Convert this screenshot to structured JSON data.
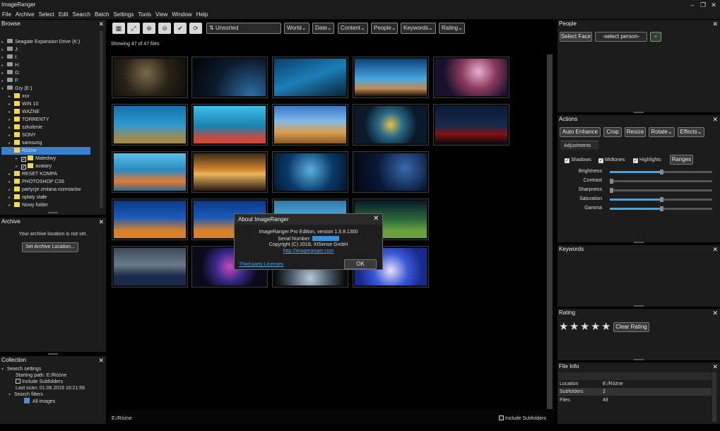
{
  "app": {
    "title": "ImageRanger"
  },
  "menu": [
    "File",
    "Archive",
    "Select",
    "Edit",
    "Search",
    "Batch",
    "Settings",
    "Tools",
    "View",
    "Window",
    "Help"
  ],
  "browse": {
    "title": "Browse",
    "items": [
      {
        "label": "Seagate Expansion Drive (K:)",
        "type": "drive"
      },
      {
        "label": "J:",
        "type": "drive"
      },
      {
        "label": "I:",
        "type": "drive"
      },
      {
        "label": "H:",
        "type": "drive"
      },
      {
        "label": "G:",
        "type": "drive"
      },
      {
        "label": "F:",
        "type": "drive"
      },
      {
        "label": "Gry (E:)",
        "type": "drive"
      },
      {
        "label": "xxx",
        "type": "folder"
      },
      {
        "label": "WIN 10",
        "type": "folder"
      },
      {
        "label": "WAŻNE",
        "type": "folder"
      },
      {
        "label": "TORRENTY",
        "type": "folder"
      },
      {
        "label": "szkolenie",
        "type": "folder"
      },
      {
        "label": "SONY",
        "type": "folder"
      },
      {
        "label": "samsung",
        "type": "folder"
      },
      {
        "label": "Różne",
        "type": "folder",
        "selected": true
      },
      {
        "label": "Malediwy",
        "type": "sub"
      },
      {
        "label": "avatary",
        "type": "sub"
      },
      {
        "label": "RESET KOMPA",
        "type": "folder"
      },
      {
        "label": "PHOTOSHOP CS6",
        "type": "folder"
      },
      {
        "label": "partycje zmiana rozmiarów",
        "type": "folder"
      },
      {
        "label": "opłaty stałe",
        "type": "folder"
      },
      {
        "label": "Nowy folder",
        "type": "folder"
      }
    ]
  },
  "archive": {
    "title": "Archive",
    "message": "Your archive location is not set.",
    "button": "Set Archive Location..."
  },
  "collection": {
    "title": "Collection",
    "search_settings": "Search settings",
    "starting_path": "Starting path: E:/Różne",
    "include_subfolders": "Include Subfolders",
    "last_scan": "Last scan: 01.06.2019 10:21:56",
    "search_filters": "Search filters",
    "all_images": "All images"
  },
  "toolbar": {
    "sort": "Unsorted",
    "filters": [
      "World",
      "Date",
      "Content",
      "People",
      "Keywords",
      "Rating"
    ]
  },
  "main": {
    "showing": "Showing 47 of 47 files",
    "path": "E:/Różne",
    "include_subfolders": "Include Subfolders",
    "badge": "2"
  },
  "dialog": {
    "title": "About ImageRanger",
    "line1": "ImageRanger Pro Edition, version 1.5.8.1300",
    "serial_label": "Serial Number:",
    "copyright": "Copyright (C) 2019, XtSense GmbH",
    "url": "http://imageranger.com",
    "third_party": "Third-party Licenses",
    "ok": "OK"
  },
  "people": {
    "title": "People",
    "select_face": "Select Face",
    "select_person": "-select person-",
    "add": "+"
  },
  "actions": {
    "title": "Actions",
    "buttons": [
      "Auto Enhance",
      "Crop",
      "Resize",
      "Rotate",
      "Effects"
    ],
    "tab": "Adjustments",
    "checks": [
      "Shadows",
      "Midtones",
      "Highlights"
    ],
    "ranges": "Ranges",
    "sliders": [
      {
        "label": "Brightness",
        "value": 0.5
      },
      {
        "label": "Contrast",
        "value": 0
      },
      {
        "label": "Sharpness",
        "value": 0
      },
      {
        "label": "Saturation",
        "value": 0.5
      },
      {
        "label": "Gamma",
        "value": 0.5
      }
    ]
  },
  "keywords": {
    "title": "Keywords"
  },
  "rating": {
    "title": "Rating",
    "stars": 5,
    "clear": "Clear Rating"
  },
  "fileinfo": {
    "title": "File Info",
    "rows": [
      {
        "key": "Location",
        "value": "E:/Różne"
      },
      {
        "key": "Subfolders",
        "value": "2"
      },
      {
        "key": "Files",
        "value": "48"
      }
    ]
  },
  "colors": {
    "accent": "#3d8fd6",
    "selection": "#3b7fd0",
    "link": "#4aa3ff"
  }
}
